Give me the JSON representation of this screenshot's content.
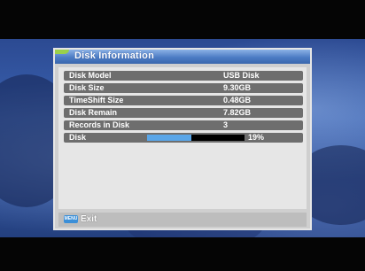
{
  "window": {
    "title": "Disk Information"
  },
  "disk_info": {
    "rows": [
      {
        "label": "Disk Model",
        "value": "USB Disk"
      },
      {
        "label": "Disk Size",
        "value": "9.30GB"
      },
      {
        "label": "TimeShift Size",
        "value": "0.48GB"
      },
      {
        "label": "Disk Remain",
        "value": "7.82GB"
      },
      {
        "label": "Records in Disk",
        "value": "3"
      }
    ],
    "usage": {
      "label": "Disk",
      "fraction": 0.19,
      "percent_text": "19%"
    }
  },
  "footer": {
    "menu_key_label": "MENU",
    "exit_label": "Exit"
  },
  "colors": {
    "title_bar": "#4c7cc4",
    "row_background": "#6e6e6e",
    "usage_fill": "#5aa6e8",
    "menu_key": "#3b8fd8"
  }
}
